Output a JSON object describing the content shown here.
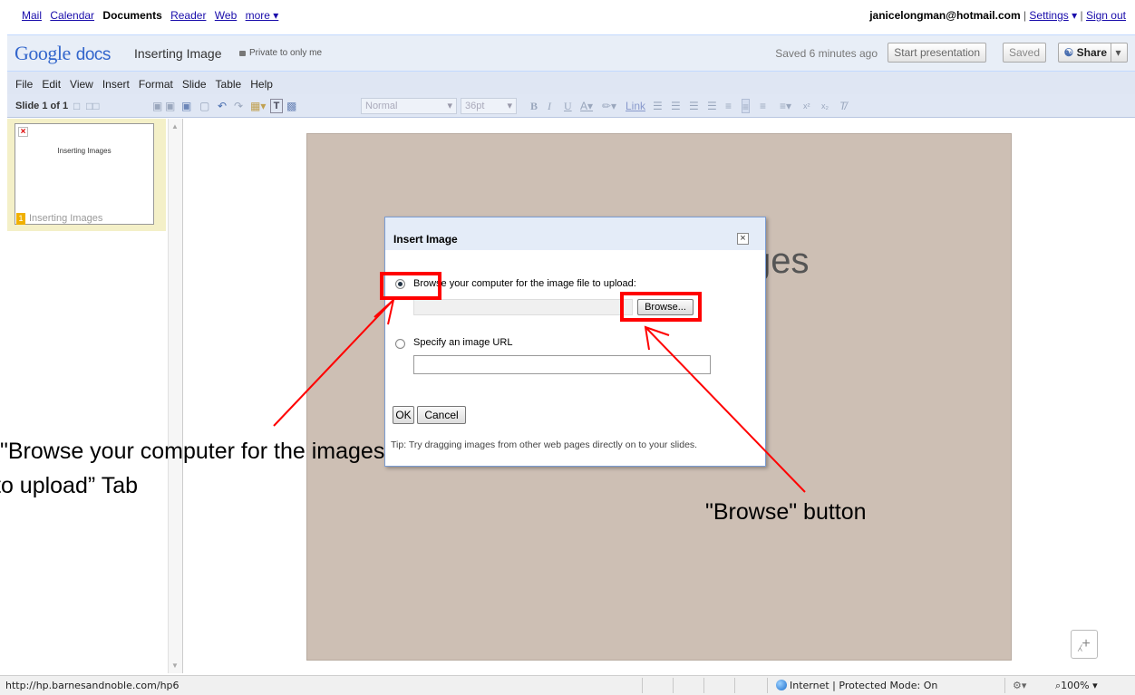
{
  "topbar": {
    "links": [
      {
        "label": "Mail",
        "active": false
      },
      {
        "label": "Calendar",
        "active": false
      },
      {
        "label": "Documents",
        "active": true
      },
      {
        "label": "Reader",
        "active": false
      },
      {
        "label": "Web",
        "active": false
      },
      {
        "label": "more ▾",
        "active": false
      }
    ],
    "account_email": "janicelongman@hotmail.com",
    "settings_label": "Settings",
    "settings_caret": "▾",
    "signout_label": "Sign out"
  },
  "header": {
    "logo_text": "Google",
    "logo_suffix": "docs",
    "doc_title": "Inserting Image",
    "privacy_label": "Private to only me",
    "saved_status": "Saved 6 minutes ago",
    "start_presentation_label": "Start presentation",
    "saved_label": "Saved",
    "share_label": "Share"
  },
  "menubar": {
    "items": [
      "File",
      "Edit",
      "View",
      "Insert",
      "Format",
      "Slide",
      "Table",
      "Help"
    ]
  },
  "toolbar": {
    "slide_count": "Slide 1 of 1",
    "style_select": "Normal",
    "size_select": "36pt",
    "link_label": "Link"
  },
  "slides_panel": {
    "thumbnail_title": "Inserting Images",
    "slide_number": "1",
    "slide_label": "Inserting Images"
  },
  "slide": {
    "title_fragment": "ges"
  },
  "dialog": {
    "title": "Insert Image",
    "option_browse_label": "Browse your computer for the image file to upload:",
    "browse_button_label": "Browse...",
    "option_url_label": "Specify an image URL",
    "url_value": "",
    "ok_label": "OK",
    "cancel_label": "Cancel",
    "tip_text": "Tip: Try dragging images from other web pages directly on to your slides.",
    "selected_option": "browse"
  },
  "annotations": {
    "label_browse_tab_line1": "\"Browse your computer for the images",
    "label_browse_tab_line2": "to upload” Tab",
    "label_browse_button": "\"Browse\" button",
    "color": "#ff0000"
  },
  "statusbar": {
    "url": "http://hp.barnesandnoble.com/hp6",
    "zone": "Internet | Protected Mode: On",
    "zoom": "100%"
  }
}
